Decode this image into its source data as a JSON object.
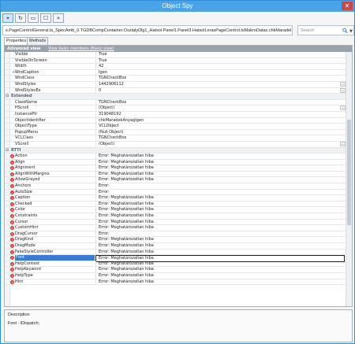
{
  "window": {
    "title": "Object Spy",
    "close_glyph": "✕"
  },
  "toolbar": {
    "buttons": [
      {
        "icon": "crosshair-icon",
        "glyph": "⌖"
      },
      {
        "icon": "refresh-icon",
        "glyph": "↻"
      },
      {
        "icon": "highlight-icon",
        "glyph": "▭"
      },
      {
        "icon": "checkbox-icon",
        "glyph": "☐"
      },
      {
        "icon": "forward-icon",
        "glyph": "»"
      }
    ]
  },
  "path": "s.PageControlGeneral.ts_SpecAmb_0.TGDBCompContainer.OsztalyDlg1_Hatsol.Panel1.Panel3.HatsolLerasPageControl.tsMakroDatas.chkMaradekAnyagIgen.Font",
  "search": {
    "placeholder": "Search",
    "dropdown_glyph": "▼"
  },
  "tabs": [
    {
      "label": "Properties",
      "active": true
    },
    {
      "label": "Methods",
      "active": false
    }
  ],
  "grid": {
    "advanced_title": "Advanced view",
    "advanced_link": "View basic members (Basic view)",
    "rows": [
      {
        "name": "Visible",
        "value": "True"
      },
      {
        "name": "VisibleOnScreen",
        "value": "True"
      },
      {
        "name": "Width",
        "value": "42"
      },
      {
        "name": "WndCaption",
        "value": "Igen",
        "plus": "+"
      },
      {
        "name": "WndClass",
        "value": "TGNCheckBox"
      },
      {
        "name": "WndStyles",
        "value": "1442906112",
        "ellipsis": "..."
      },
      {
        "name": "WndStylesEx",
        "value": "0",
        "ellipsis": "..."
      },
      {
        "category": true,
        "name": "Extended"
      },
      {
        "name": "ClassName",
        "value": "TGNCheckBox"
      },
      {
        "name": "HScroll",
        "value": "(Object)",
        "ellipsis": "..."
      },
      {
        "name": "InstancePtr",
        "value": "319048192"
      },
      {
        "name": "ObjectIdentifier",
        "value": "chkMaradekAnyagIgen"
      },
      {
        "name": "ObjectType",
        "value": "VCLObject"
      },
      {
        "name": "PopupMenu",
        "value": "(Null Object)"
      },
      {
        "name": "VCLClass",
        "value": "TGNCheckBox"
      },
      {
        "name": "VScroll",
        "value": "(Object)",
        "ellipsis": "..."
      },
      {
        "category": true,
        "name": "RTTI"
      },
      {
        "name": "Action",
        "value": "Error: Meghatározatlan hiba",
        "error": true
      },
      {
        "name": "Align",
        "value": "Error: Meghatározatlan hiba",
        "error": true
      },
      {
        "name": "Alignment",
        "value": "Error: Meghatározatlan hiba",
        "error": true
      },
      {
        "name": "AlignWithMargins",
        "value": "Error: Meghatározatlan hiba",
        "error": true
      },
      {
        "name": "AllowGrayed",
        "value": "Error: Meghatározatlan hiba",
        "error": true
      },
      {
        "name": "Anchors",
        "value": "Error:",
        "error": true
      },
      {
        "name": "AutoSize",
        "value": "Error:",
        "error": true
      },
      {
        "name": "Caption",
        "value": "Error: Meghatározatlan hiba",
        "error": true
      },
      {
        "name": "Checked",
        "value": "Error: Meghatározatlan hiba",
        "error": true
      },
      {
        "name": "Color",
        "value": "Error: Meghatározatlan hiba",
        "error": true
      },
      {
        "name": "Constraints",
        "value": "Error: Meghatározatlan hiba",
        "error": true
      },
      {
        "name": "Cursor",
        "value": "Error: Meghatározatlan hiba",
        "error": true
      },
      {
        "name": "CustomHint",
        "value": "Error: Meghatározatlan hiba",
        "error": true
      },
      {
        "name": "DragCursor",
        "value": "Error:",
        "error": true
      },
      {
        "name": "DragKind",
        "value": "Error: Meghatározatlan hiba",
        "error": true
      },
      {
        "name": "DragMode",
        "value": "Error: Meghatározatlan hiba",
        "error": true
      },
      {
        "name": "FakeStyleController",
        "value": "Error: Meghatározatlan hiba",
        "error": true
      },
      {
        "name": "Font",
        "value": "Error: Meghatározatlan hiba",
        "error": true,
        "selected": true
      },
      {
        "name": "HelpContext",
        "value": "Error: Meghatározatlan hiba",
        "error": true
      },
      {
        "name": "HelpKeyword",
        "value": "Error: Meghatározatlan hiba",
        "error": true
      },
      {
        "name": "HelpType",
        "value": "Error: Meghatározatlan hiba",
        "error": true
      },
      {
        "name": "Hint",
        "value": "Error: Meghatározatlan hiba",
        "error": true
      }
    ]
  },
  "description": {
    "title": "Description",
    "text": "Font : IDispatch;"
  },
  "error_glyph": "×",
  "category_glyph": "⊟"
}
